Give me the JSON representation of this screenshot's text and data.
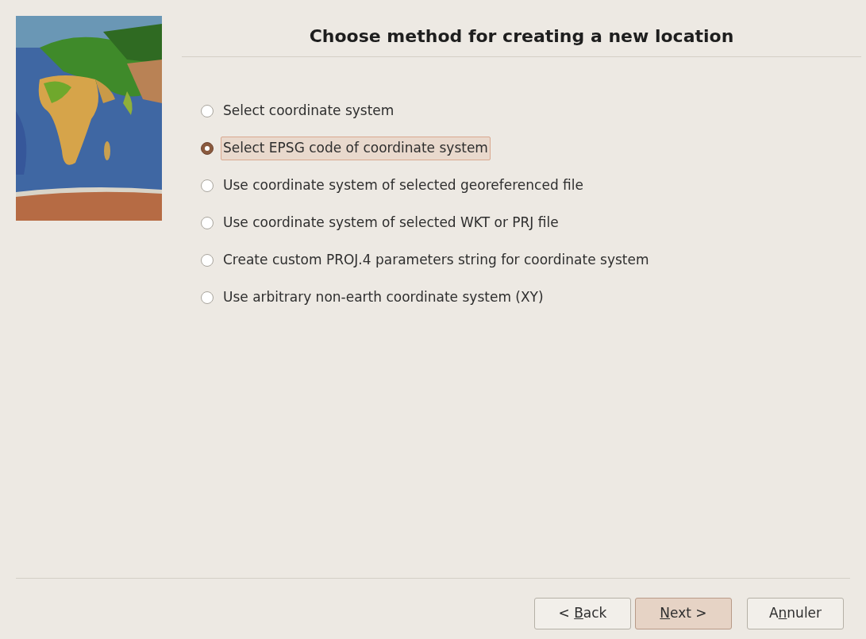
{
  "header": {
    "title": "Choose method for creating a new location"
  },
  "options": [
    {
      "label": "Select coordinate system",
      "selected": false
    },
    {
      "label": "Select EPSG code of coordinate system",
      "selected": true
    },
    {
      "label": "Use coordinate system of selected georeferenced file",
      "selected": false
    },
    {
      "label": "Use coordinate system of selected WKT or PRJ file",
      "selected": false
    },
    {
      "label": "Create custom PROJ.4 parameters string for coordinate system",
      "selected": false
    },
    {
      "label": "Use arbitrary non-earth coordinate system (XY)",
      "selected": false
    }
  ],
  "buttons": [
    {
      "before": "< ",
      "key": "B",
      "after": "ack",
      "default": false
    },
    {
      "key": "N",
      "after": "ext >",
      "default": true
    },
    {
      "before": "A",
      "key": "n",
      "after": "nuler",
      "default": false
    }
  ]
}
